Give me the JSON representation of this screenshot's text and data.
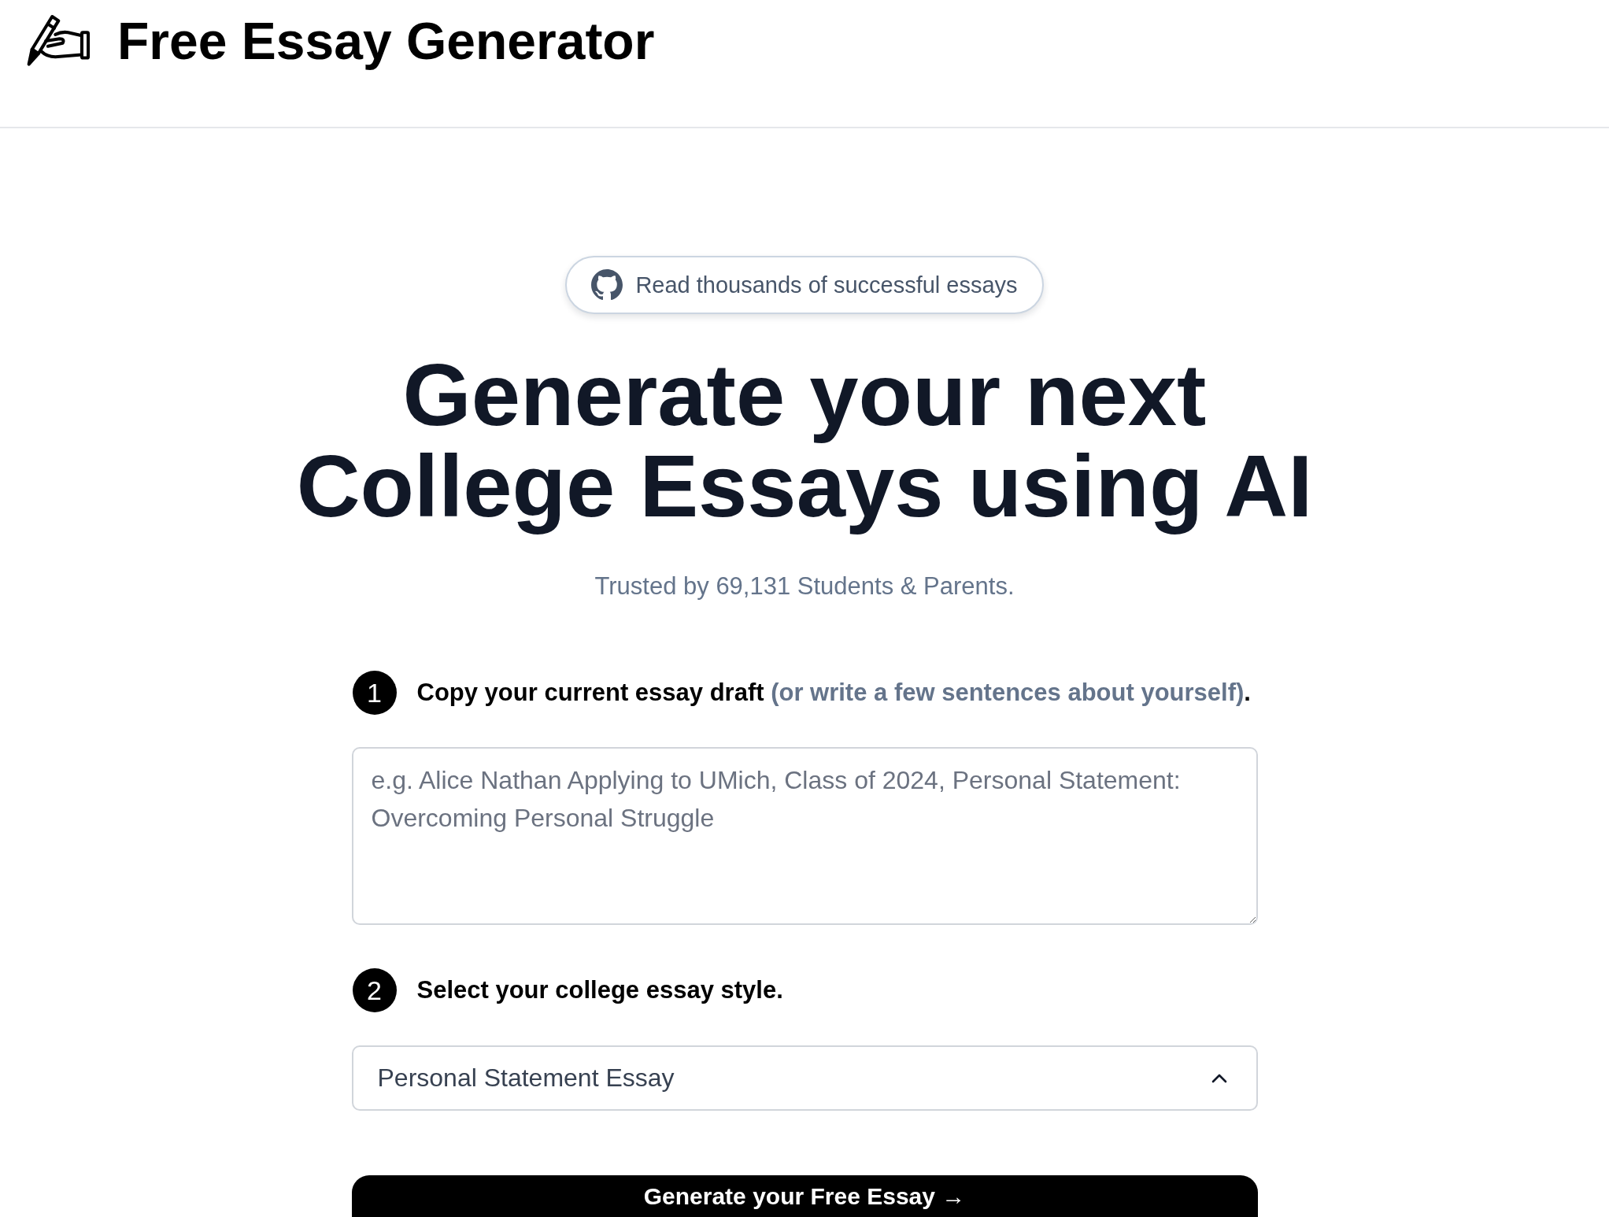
{
  "header": {
    "title": "Free Essay Generator"
  },
  "hero": {
    "link": "Read thousands of successful essays",
    "heading": "Generate your next College Essays using AI",
    "subtitle": "Trusted by 69,131 Students & Parents."
  },
  "steps": [
    {
      "number": "1",
      "label_parts": [
        {
          "text": "Copy your current essay draft",
          "muted": false
        },
        {
          "text": " (or write a few sentences about yourself)",
          "muted": true
        },
        {
          "text": ".",
          "muted": false
        }
      ],
      "field": {
        "kind": "textarea",
        "placeholder": "e.g. Alice Nathan Applying to UMich, Class of 2024, Personal Statement: Overcoming Personal Struggle"
      }
    },
    {
      "number": "2",
      "label_parts": [
        {
          "text": "Select your college essay style.",
          "muted": false
        }
      ],
      "field": {
        "kind": "select",
        "value": "Personal Statement Essay"
      }
    }
  ],
  "submit_button": "Generate your Free Essay →"
}
